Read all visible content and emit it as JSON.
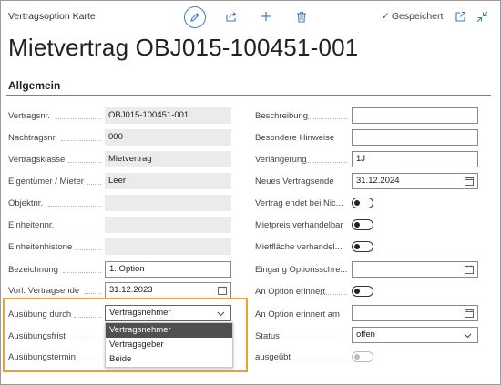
{
  "header": {
    "page_caption": "Vertragsoption Karte",
    "saved_status": "Gespeichert",
    "title": "Mietvertrag OBJ015-100451-001"
  },
  "section": {
    "title": "Allgemein"
  },
  "left_fields": [
    {
      "label": "Vertragsnr.",
      "value": "OBJ015-100451-001"
    },
    {
      "label": "Nachtragsnr.",
      "value": "000"
    },
    {
      "label": "Vertragsklasse",
      "value": "Mietvertrag"
    },
    {
      "label": "Eigentümer / Mieter",
      "value": "Leer"
    },
    {
      "label": "Objektnr.",
      "value": ""
    },
    {
      "label": "Einheitennr.",
      "value": ""
    },
    {
      "label": "Einheitenhistorie",
      "value": ""
    },
    {
      "label": "Bezeichnung",
      "value": "1. Option"
    },
    {
      "label": "Vorl. Vertragsende",
      "value": "31.12.2023"
    },
    {
      "label": "Ausübung durch",
      "value": "Vertragsnehmer"
    },
    {
      "label": "Ausübungsfrist",
      "value": ""
    },
    {
      "label": "Ausübungstermin",
      "value": ""
    }
  ],
  "right_fields": [
    {
      "label": "Beschreibung",
      "value": ""
    },
    {
      "label": "Besondere Hinweise",
      "value": ""
    },
    {
      "label": "Verlängerung",
      "value": "1J"
    },
    {
      "label": "Neues Vertragsende",
      "value": "31.12.2024"
    },
    {
      "label": "Vertrag endet bei Nic...",
      "value": "off"
    },
    {
      "label": "Mietpreis verhandelbar",
      "value": "off"
    },
    {
      "label": "Mietfläche verhandel...",
      "value": "off"
    },
    {
      "label": "Eingang Optionsschre...",
      "value": ""
    },
    {
      "label": "An Option erinnert",
      "value": "off"
    },
    {
      "label": "An Option erinnert am",
      "value": ""
    },
    {
      "label": "Status",
      "value": "offen"
    },
    {
      "label": "ausgeübt",
      "value": "off (disabled)"
    }
  ],
  "dropdown_options": [
    "Vertragsnehmer",
    "Vertragsgeber",
    "Beide"
  ],
  "colors": {
    "accent": "#3b7ec2",
    "highlight": "#f0a030",
    "selected_option": "#505050"
  },
  "icons": [
    "edit-icon",
    "share-icon",
    "plus-icon",
    "trash-icon",
    "checkmark-icon",
    "open-new-window-icon",
    "collapse-icon",
    "calendar-icon",
    "chevron-down-icon"
  ]
}
